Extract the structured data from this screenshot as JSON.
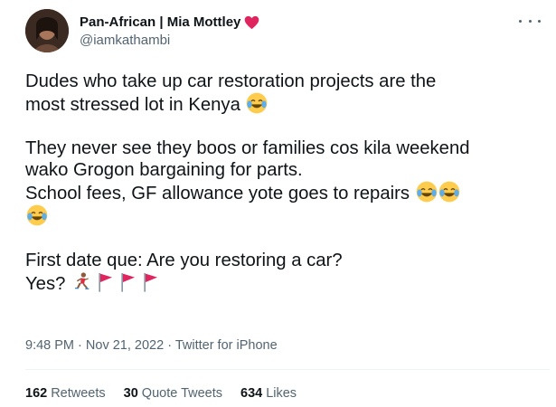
{
  "author": {
    "display_name": "Pan-African | Mia Mottley",
    "handle": "@iamkathambi",
    "name_emoji": "red-heart"
  },
  "tweet": {
    "line1": "Dudes who take up car restoration projects are the",
    "line2": "most stressed lot in Kenya ",
    "line4": "They never see they boos or families cos kila weekend",
    "line5": "wako Grogon bargaining for parts.",
    "line6": "School fees, GF allowance yote goes to repairs ",
    "line9": "First date que: Are you restoring a car?",
    "line10": "Yes? "
  },
  "meta": {
    "time": "9:48 PM",
    "sep1": "·",
    "date": "Nov 21, 2022",
    "sep2": "·",
    "source": "Twitter for iPhone"
  },
  "stats": {
    "retweets_count": "162",
    "retweets_label": "Retweets",
    "quotes_count": "30",
    "quotes_label": "Quote Tweets",
    "likes_count": "634",
    "likes_label": "Likes"
  },
  "icons": {
    "more": "more-horizontal-icon",
    "laugh": "face-with-tears-of-joy-emoji",
    "runner": "woman-running-emoji",
    "flag": "red-flag-emoji"
  },
  "colors": {
    "text": "#0f1419",
    "secondary": "#536471",
    "divider": "#eff3f4",
    "heart": "#e0245e",
    "flag": "#e0245e"
  }
}
